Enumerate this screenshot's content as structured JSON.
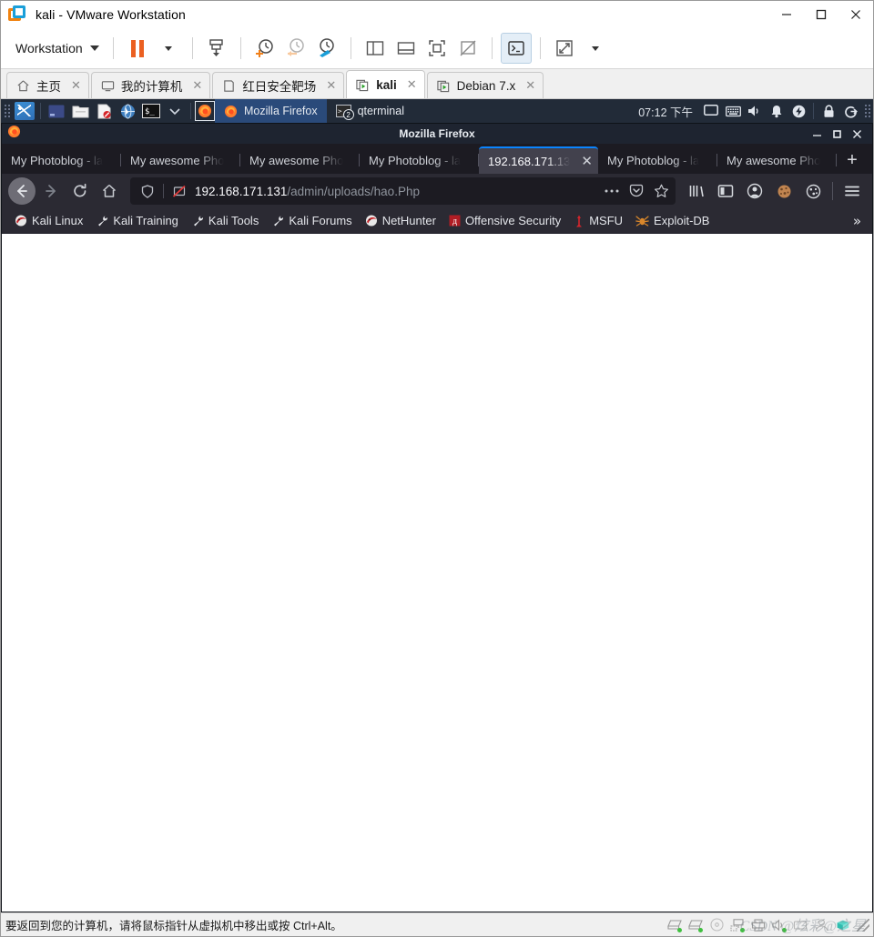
{
  "vmware": {
    "title": "kali - VMware Workstation",
    "menu_label": "Workstation",
    "window_buttons": {
      "minimize": "minimize-icon",
      "maximize": "maximize-icon",
      "close": "close-icon"
    },
    "toolbar_icons": [
      "pause-icon",
      "pause-dropdown-caret",
      "send-ctrl-alt-del-icon",
      "take-snapshot-icon",
      "revert-snapshot-icon",
      "snapshot-manager-icon",
      "show-library-icon",
      "show-thumbnail-bar-icon",
      "fullscreen-icon",
      "unity-mode-icon",
      "console-view-icon",
      "stretch-view-icon",
      "view-dropdown-caret"
    ],
    "tabs": [
      {
        "label": "主页",
        "icon": "home-icon",
        "active": false
      },
      {
        "label": "我的计算机",
        "icon": "computer-icon",
        "active": false
      },
      {
        "label": "红日安全靶场",
        "icon": "folder-icon",
        "active": false
      },
      {
        "label": "kali",
        "icon": "vm-running-icon",
        "active": true
      },
      {
        "label": "Debian 7.x",
        "icon": "vm-running-icon",
        "active": false
      }
    ],
    "status_text": "要返回到您的计算机，请将鼠标指针从虚拟机中移出或按 Ctrl+Alt。",
    "status_icons": [
      "hard-disk-icon",
      "hard-disk-icon",
      "cd-dvd-icon",
      "network-adapter-icon",
      "printer-icon",
      "sound-card-icon",
      "usb-icon",
      "camera-icon",
      "display-icon"
    ],
    "watermark": "CSDN @炫彩@之星"
  },
  "kali_panel": {
    "launchers": [
      "kali-menu-icon",
      "show-desktop-icon",
      "file-manager-icon",
      "text-editor-icon",
      "web-browser-icon",
      "terminal-icon",
      "terminal-dropdown-caret",
      "firefox-launcher-icon"
    ],
    "tasks": [
      {
        "label": "Mozilla Firefox",
        "icon": "firefox-icon",
        "active": true
      },
      {
        "label": "qterminal",
        "icon": "terminal-icon",
        "badge": "2",
        "active": false
      }
    ],
    "clock": "07:12 下午",
    "tray_icons": [
      "display-settings-icon",
      "keyboard-layout-icon",
      "volume-icon",
      "notification-bell-icon",
      "power-manager-icon",
      "lock-screen-icon",
      "logout-icon",
      "panel-grip-icon"
    ]
  },
  "firefox": {
    "window_title": "Mozilla Firefox",
    "window_buttons": {
      "minimize": "minimize-icon",
      "maximize": "maximize-icon",
      "close": "close-icon"
    },
    "tabs": [
      {
        "label": "My Photoblog - la",
        "active": false
      },
      {
        "label": "My awesome Pho",
        "active": false
      },
      {
        "label": "My awesome Pho",
        "active": false
      },
      {
        "label": "My Photoblog - la",
        "active": false
      },
      {
        "label": "192.168.171.13",
        "active": true
      },
      {
        "label": "My Photoblog - la",
        "active": false
      },
      {
        "label": "My awesome Pho",
        "active": false
      }
    ],
    "new_tab_label": "+",
    "nav": {
      "back": "back-arrow-icon",
      "forward": "forward-arrow-icon",
      "reload": "reload-icon",
      "home": "home-icon"
    },
    "urlbar": {
      "shield_icon": "tracking-protection-shield-icon",
      "permission_icon": "permissions-blocked-icon",
      "url_host": "192.168.171.131",
      "url_path": "/admin/uploads/hao.Php",
      "page_actions_icon": "page-actions-ellipsis-icon",
      "pocket_icon": "save-to-pocket-icon",
      "bookmark_icon": "bookmark-star-icon"
    },
    "toolbar_icons": [
      "library-icon",
      "sidebar-icon",
      "account-icon",
      "cookie-icon",
      "container-tabs-icon",
      "app-menu-icon"
    ],
    "bookmarks": [
      {
        "label": "Kali Linux",
        "icon": "kali-dragon-icon"
      },
      {
        "label": "Kali Training",
        "icon": "wrench-icon"
      },
      {
        "label": "Kali Tools",
        "icon": "wrench-icon"
      },
      {
        "label": "Kali Forums",
        "icon": "wrench-icon"
      },
      {
        "label": "NetHunter",
        "icon": "kali-dragon-icon"
      },
      {
        "label": "Offensive Security",
        "icon": "offsec-icon"
      },
      {
        "label": "MSFU",
        "icon": "metasploit-icon"
      },
      {
        "label": "Exploit-DB",
        "icon": "exploit-db-icon"
      }
    ],
    "bookmarks_overflow": "»",
    "page_content": ""
  },
  "colors": {
    "vmware_orange": "#eb6021",
    "vmware_blue": "#1a9fd9",
    "firefox_tab_accent": "#0a84ff",
    "kali_panel_bg": "#222b38",
    "kali_active_task": "#2a4a7a"
  }
}
